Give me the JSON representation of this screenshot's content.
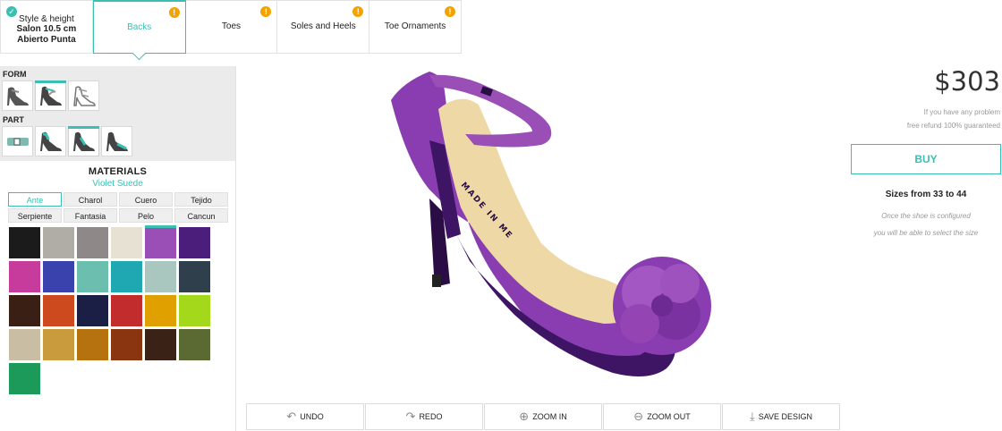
{
  "steps": [
    {
      "title": "Style & height",
      "subtitle": "Salon 10.5 cm Abierto Punta",
      "status": "done"
    },
    {
      "label": "Backs",
      "status": "warning"
    },
    {
      "label": "Toes",
      "status": "warning"
    },
    {
      "label": "Soles and Heels",
      "status": "warning"
    },
    {
      "label": "Toe Ornaments",
      "status": "warning"
    }
  ],
  "badges": {
    "ok": "✓",
    "warn": "!"
  },
  "left": {
    "form_label": "FORM",
    "part_label": "PART",
    "materials_title": "MATERIALS",
    "selected_material": "Violet Suede",
    "material_tabs": [
      "Ante",
      "Charol",
      "Cuero",
      "Tejido",
      "Serpiente",
      "Fantasia",
      "Pelo",
      "Cancun"
    ],
    "active_tab": "Ante",
    "swatch_colors": [
      "#1b1b1b",
      "#b0ada6",
      "#8f8888",
      "#e6e1d2",
      "#9a4fb6",
      "#4a1e7a",
      "#c63b9c",
      "#3a43ad",
      "#6cbfae",
      "#1fa7b2",
      "#a9c6bf",
      "#2f3f4c",
      "#3a1f14",
      "#cc4a1e",
      "#1c1f45",
      "#c22c2c",
      "#e0a100",
      "#a4d81a",
      "#c9bea3",
      "#c99b3c",
      "#b5720f",
      "#8a3510",
      "#3a2216",
      "#5a6a32",
      "#1b9a5a"
    ],
    "selected_swatch": 4
  },
  "toolbar": {
    "undo": "UNDO",
    "redo": "REDO",
    "zoom_in": "ZOOM IN",
    "zoom_out": "ZOOM OUT",
    "save": "SAVE DESIGN"
  },
  "viewer": {
    "insole_text": "MADE IN ME",
    "colors": {
      "upper": "#8a3db0",
      "dark": "#3e1464",
      "insole": "#eed9a6",
      "flower": "#9445b3"
    }
  },
  "right": {
    "price": "$303",
    "refund_line1": "If you have any problem",
    "refund_line2": "free refund 100% guaranteed",
    "buy_label": "BUY",
    "sizes": "Sizes from 33 to 44",
    "size_note1": "Once the shoe is configured",
    "size_note2": "you will be able to select the size"
  },
  "colors": {
    "accent": "#3bbfb2",
    "warning": "#f2a300"
  }
}
